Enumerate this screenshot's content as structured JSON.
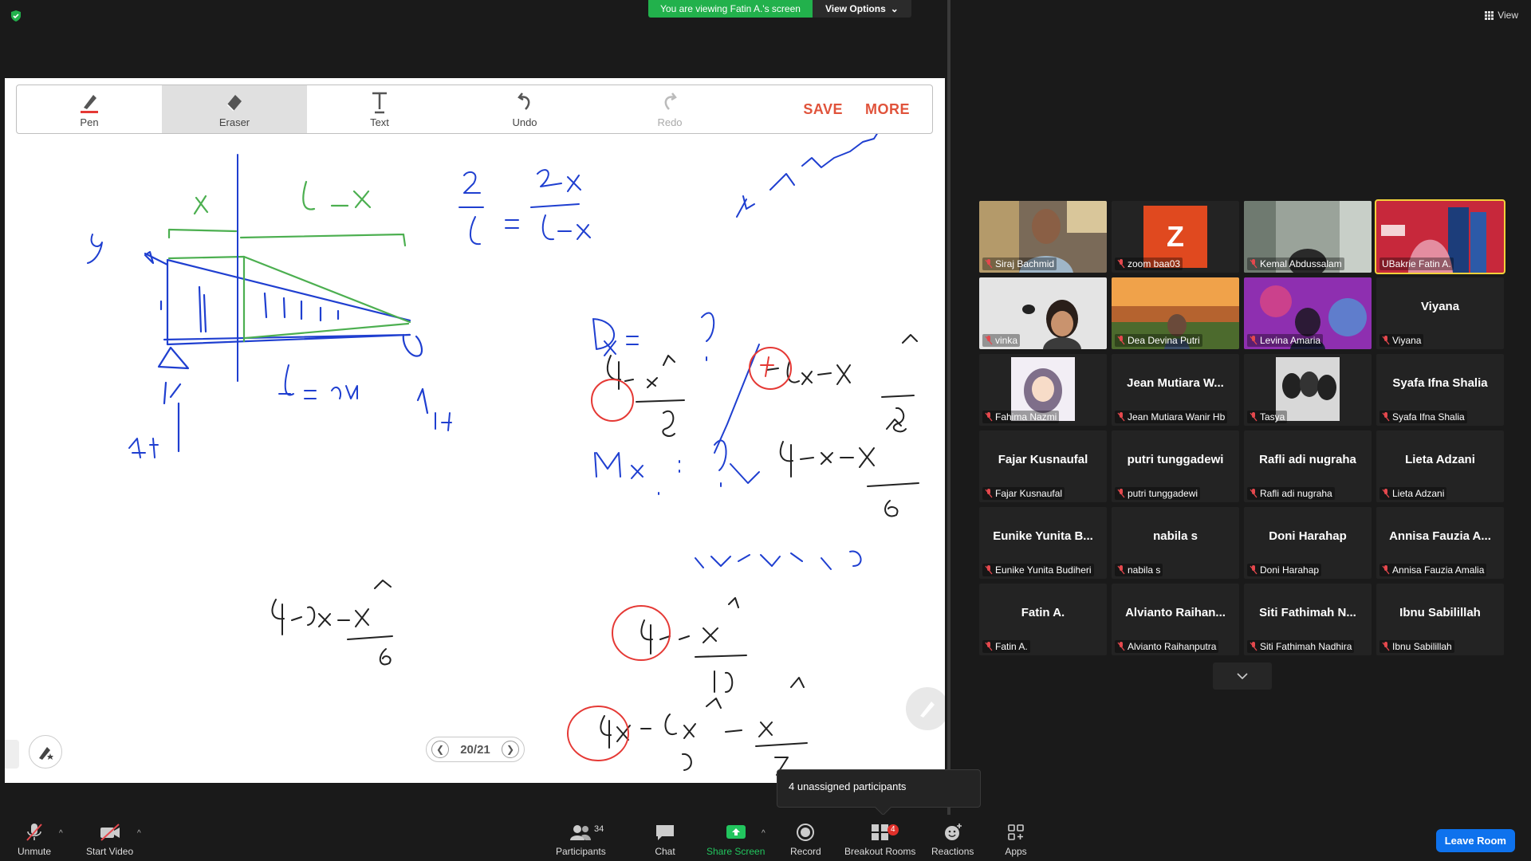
{
  "banner": {
    "viewing_text": "You are viewing Fatin A.'s screen",
    "view_options_label": "View Options",
    "view_label": "View"
  },
  "whiteboard": {
    "tools": [
      {
        "label": "Pen",
        "icon": "pen-icon"
      },
      {
        "label": "Eraser",
        "icon": "eraser-icon",
        "active": true
      },
      {
        "label": "Text",
        "icon": "text-icon"
      },
      {
        "label": "Undo",
        "icon": "undo-icon"
      },
      {
        "label": "Redo",
        "icon": "redo-icon",
        "disabled": true
      }
    ],
    "save_label": "SAVE",
    "more_label": "MORE",
    "page_indicator": "20/21",
    "ink_blue": "#1f3fd0",
    "ink_green": "#4caf50",
    "ink_red": "#e53935",
    "ink_black": "#222222"
  },
  "participants": [
    {
      "name": "Siraj Bachmid",
      "video": true
    },
    {
      "name": "zoom baa03",
      "avatar_letter": "Z"
    },
    {
      "name": "Kemal Abdussalam",
      "video": true
    },
    {
      "name": "UBakrie Fatin A.",
      "video": true,
      "active_speaker": true
    },
    {
      "name": "vinka",
      "video": true
    },
    {
      "name": "Dea Devina Putri",
      "video": true
    },
    {
      "name": "Levina Amaria",
      "video": true
    },
    {
      "name": "Viyana",
      "display": "Viyana"
    },
    {
      "name": "Fahima Nazmi",
      "video": true
    },
    {
      "name": "Jean Mutiara Wanir Hb",
      "display": "Jean Mutiara W..."
    },
    {
      "name": "Tasya",
      "video": true
    },
    {
      "name": "Syafa Ifna Shalia",
      "display": "Syafa Ifna Shalia"
    },
    {
      "name": "Fajar Kusnaufal",
      "display": "Fajar Kusnaufal"
    },
    {
      "name": "putri tunggadewi",
      "display": "putri tunggadewi"
    },
    {
      "name": "Rafli adi nugraha",
      "display": "Rafli adi nugraha"
    },
    {
      "name": "Lieta Adzani",
      "display": "Lieta Adzani"
    },
    {
      "name": "Eunike Yunita Budiheri",
      "display": "Eunike Yunita B..."
    },
    {
      "name": "nabila s",
      "display": "nabila s"
    },
    {
      "name": "Doni Harahap",
      "display": "Doni Harahap"
    },
    {
      "name": "Annisa Fauzia Amalia",
      "display": "Annisa Fauzia A..."
    },
    {
      "name": "Fatin A.",
      "display": "Fatin A."
    },
    {
      "name": "Alvianto Raihanputra",
      "display": "Alvianto  Raihan..."
    },
    {
      "name": "Siti Fathimah Nadhira",
      "display": "Siti  Fathimah  N..."
    },
    {
      "name": "Ibnu Sabilillah",
      "display": "Ibnu Sabilillah"
    }
  ],
  "tooltip": "4 unassigned participants",
  "controls": {
    "unmute": "Unmute",
    "start_video": "Start Video",
    "participants": "Participants",
    "participants_count": "34",
    "chat": "Chat",
    "share_screen": "Share Screen",
    "record": "Record",
    "breakout_rooms": "Breakout Rooms",
    "breakout_badge": "4",
    "reactions": "Reactions",
    "apps": "Apps",
    "leave": "Leave Room"
  }
}
